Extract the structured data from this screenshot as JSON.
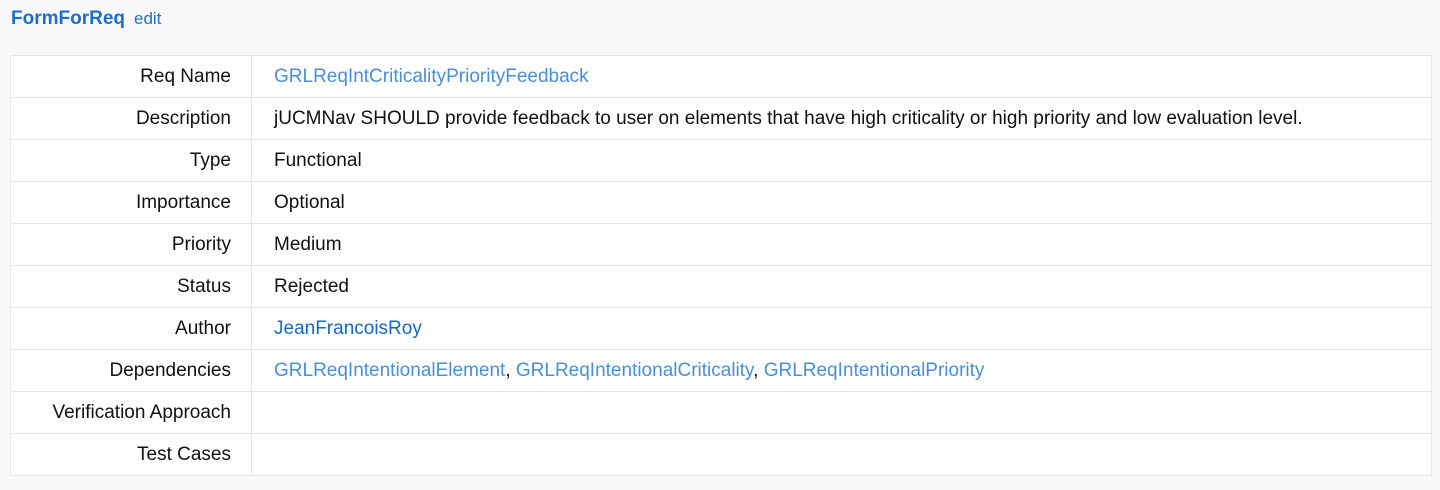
{
  "header": {
    "title": "FormForReq",
    "edit_label": "edit"
  },
  "rows": {
    "req_name": {
      "label": "Req Name",
      "value": "GRLReqIntCriticalityPriorityFeedback"
    },
    "description": {
      "label": "Description",
      "value": "jUCMNav SHOULD provide feedback to user on elements that have high criticality or high priority and low evaluation level."
    },
    "type": {
      "label": "Type",
      "value": "Functional"
    },
    "importance": {
      "label": "Importance",
      "value": "Optional"
    },
    "priority": {
      "label": "Priority",
      "value": "Medium"
    },
    "status": {
      "label": "Status",
      "value": "Rejected"
    },
    "author": {
      "label": "Author",
      "value": "JeanFrancoisRoy"
    },
    "dependencies": {
      "label": "Dependencies",
      "items": [
        "GRLReqIntentionalElement",
        "GRLReqIntentionalCriticality",
        "GRLReqIntentionalPriority"
      ],
      "separator": ", "
    },
    "verification_approach": {
      "label": "Verification Approach",
      "value": ""
    },
    "test_cases": {
      "label": "Test Cases",
      "value": ""
    }
  },
  "colors": {
    "title_link": "#1f6fc6",
    "page_link": "#4a8fd6",
    "user_link": "#1668c2",
    "border": "#e6e6e6",
    "background": "#f9f9f9"
  }
}
